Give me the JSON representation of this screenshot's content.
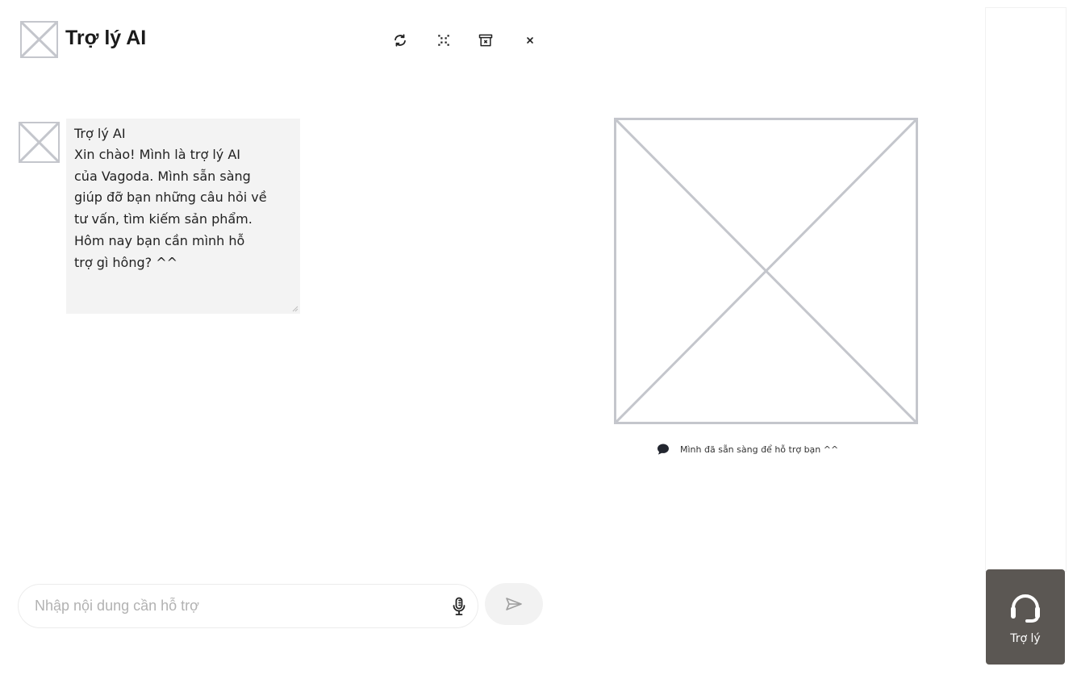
{
  "header": {
    "title": "Trợ lý AI",
    "logo_icon": "image-placeholder-icon",
    "actions": [
      {
        "name": "refresh",
        "icon": "refresh-icon"
      },
      {
        "name": "collapse",
        "icon": "collapse-icon"
      },
      {
        "name": "clear-chat",
        "icon": "trash-box-icon"
      },
      {
        "name": "close",
        "icon": "close-icon"
      }
    ]
  },
  "conversation": {
    "messages": [
      {
        "sender": "Trợ lý AI",
        "text": "Xin chào!  Mình là trợ lý AI\ncủa Vagoda. Mình sẵn sàng\ngiúp đỡ bạn những câu hỏi về\ntư vấn, tìm kiếm sản phẩm.\nHôm nay bạn cần mình hỗ\ntrợ gì hông? ^^"
      }
    ]
  },
  "illustration": {
    "status_text": "Mình đã sẵn sàng để hỗ trợ bạn ^^",
    "status_icon": "chat-bubble-icon"
  },
  "composer": {
    "placeholder": "Nhập nội dung cần hỗ trợ",
    "value": "",
    "mic_icon": "microphone-icon",
    "send_icon": "send-icon"
  },
  "launcher": {
    "label": "Trợ lý",
    "icon": "headset-icon"
  },
  "colors": {
    "bubble_bg": "#f3f3f3",
    "launcher_bg": "#5b5753",
    "placeholder_border": "#c4c6cc",
    "send_bg": "#f2f2f2"
  }
}
